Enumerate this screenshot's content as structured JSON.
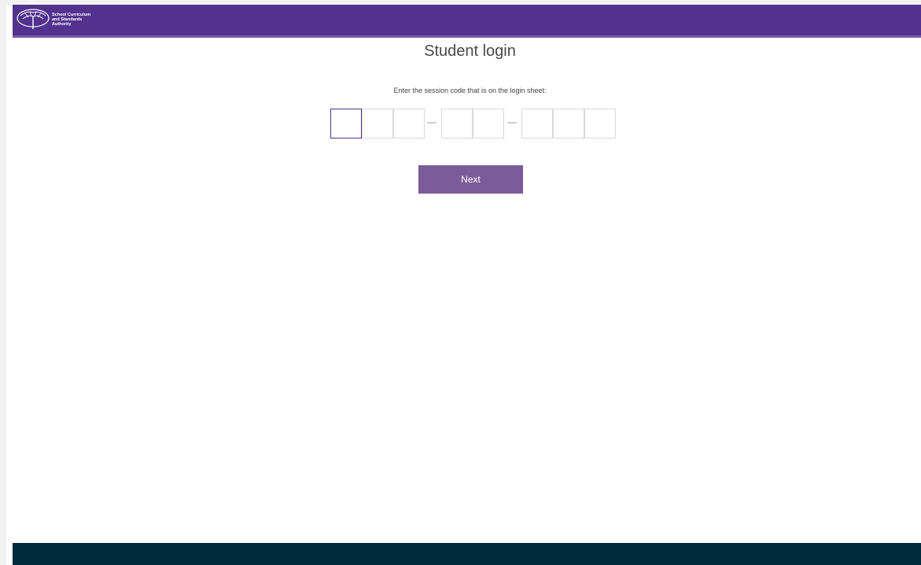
{
  "brand": {
    "name_line1": "School Curriculum",
    "name_line2": "and Standards",
    "name_line3": "Authority",
    "header_color": "#52318f",
    "footer_color": "#002b3c",
    "button_color": "#7b5b9a"
  },
  "page": {
    "title": "Student login",
    "instruction": "Enter the session code that is on the login sheet:"
  },
  "session_code": {
    "groups": [
      3,
      2,
      3
    ],
    "values": [
      "",
      "",
      "",
      "",
      "",
      "",
      "",
      ""
    ],
    "separator": "–"
  },
  "actions": {
    "next_label": "Next"
  }
}
